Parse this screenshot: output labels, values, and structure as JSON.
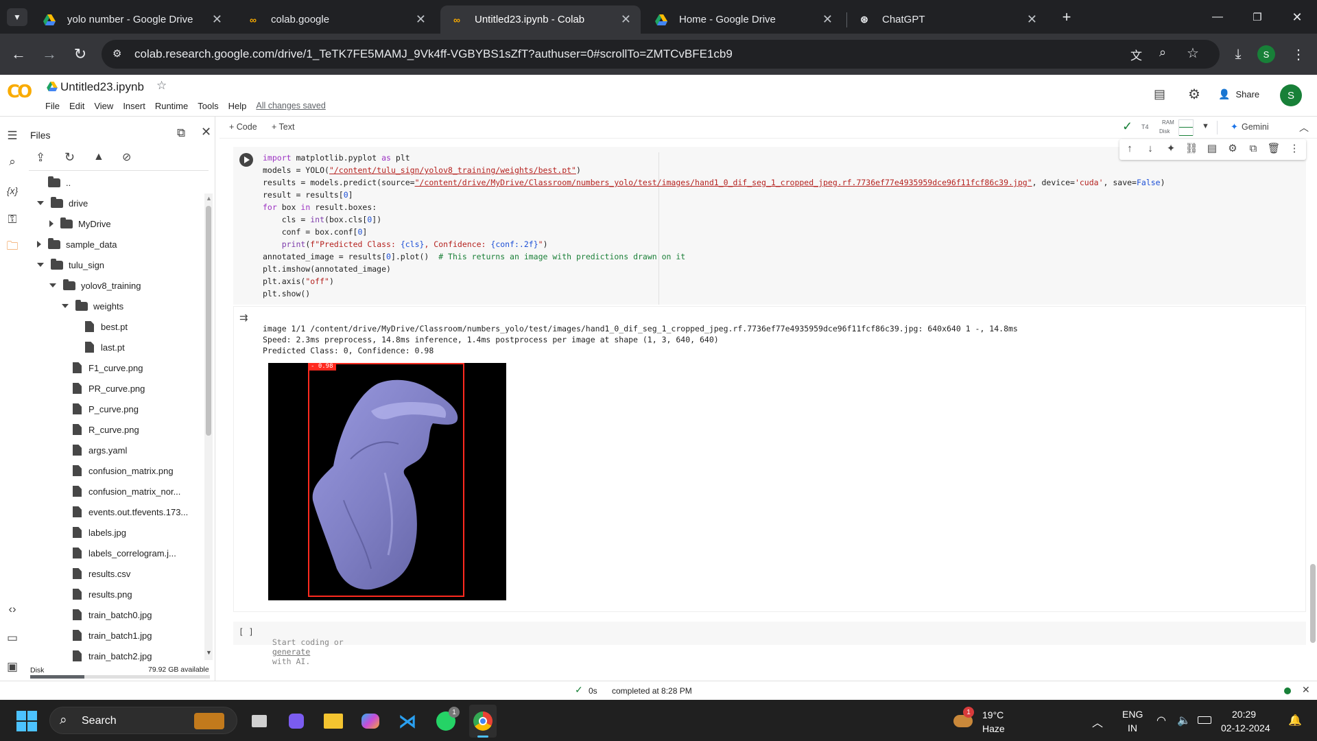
{
  "browser": {
    "tabs": [
      {
        "title": "yolo number - Google Drive",
        "icon": "google-drive-icon",
        "active": false
      },
      {
        "title": "colab.google",
        "icon": "colab-icon",
        "active": false
      },
      {
        "title": "Untitled23.ipynb - Colab",
        "icon": "colab-icon",
        "active": true
      },
      {
        "title": "Home - Google Drive",
        "icon": "google-drive-icon",
        "active": false
      },
      {
        "title": "ChatGPT",
        "icon": "chatgpt-icon",
        "active": false
      }
    ],
    "url": "colab.research.google.com/drive/1_TeTK7FE5MAMJ_9Vk4ff-VGBYBS1sZfT?authuser=0#scrollTo=ZMTCvBFE1cb9",
    "profile_initial": "S"
  },
  "colab": {
    "logo": "CO",
    "notebook_title": "Untitled23.ipynb",
    "menu": [
      "File",
      "Edit",
      "View",
      "Insert",
      "Runtime",
      "Tools",
      "Help"
    ],
    "save_status": "All changes saved",
    "share_label": "Share",
    "user_initial": "S",
    "add_code": "+ Code",
    "add_text": "+ Text",
    "runtime_type": "T4",
    "ram_label": "RAM",
    "disk_label": "Disk",
    "gemini_label": "Gemini"
  },
  "sidebar": {
    "title": "Files",
    "tree": [
      {
        "label": "..",
        "type": "folder",
        "depth": 0,
        "caret": "none"
      },
      {
        "label": "drive",
        "type": "folder",
        "depth": 0,
        "caret": "down"
      },
      {
        "label": "MyDrive",
        "type": "folder",
        "depth": 1,
        "caret": "right"
      },
      {
        "label": "sample_data",
        "type": "folder",
        "depth": 0,
        "caret": "right"
      },
      {
        "label": "tulu_sign",
        "type": "folder",
        "depth": 0,
        "caret": "down"
      },
      {
        "label": "yolov8_training",
        "type": "folder",
        "depth": 1,
        "caret": "down"
      },
      {
        "label": "weights",
        "type": "folder",
        "depth": 2,
        "caret": "down"
      },
      {
        "label": "best.pt",
        "type": "file",
        "depth": 3,
        "caret": "none"
      },
      {
        "label": "last.pt",
        "type": "file",
        "depth": 3,
        "caret": "none"
      },
      {
        "label": "F1_curve.png",
        "type": "file",
        "depth": 2,
        "caret": "none"
      },
      {
        "label": "PR_curve.png",
        "type": "file",
        "depth": 2,
        "caret": "none"
      },
      {
        "label": "P_curve.png",
        "type": "file",
        "depth": 2,
        "caret": "none"
      },
      {
        "label": "R_curve.png",
        "type": "file",
        "depth": 2,
        "caret": "none"
      },
      {
        "label": "args.yaml",
        "type": "file",
        "depth": 2,
        "caret": "none"
      },
      {
        "label": "confusion_matrix.png",
        "type": "file",
        "depth": 2,
        "caret": "none"
      },
      {
        "label": "confusion_matrix_nor...",
        "type": "file",
        "depth": 2,
        "caret": "none"
      },
      {
        "label": "events.out.tfevents.173...",
        "type": "file",
        "depth": 2,
        "caret": "none"
      },
      {
        "label": "labels.jpg",
        "type": "file",
        "depth": 2,
        "caret": "none"
      },
      {
        "label": "labels_correlogram.j...",
        "type": "file",
        "depth": 2,
        "caret": "none"
      },
      {
        "label": "results.csv",
        "type": "file",
        "depth": 2,
        "caret": "none"
      },
      {
        "label": "results.png",
        "type": "file",
        "depth": 2,
        "caret": "none"
      },
      {
        "label": "train_batch0.jpg",
        "type": "file",
        "depth": 2,
        "caret": "none"
      },
      {
        "label": "train_batch1.jpg",
        "type": "file",
        "depth": 2,
        "caret": "none"
      },
      {
        "label": "train_batch2.jpg",
        "type": "file",
        "depth": 2,
        "caret": "none"
      }
    ],
    "disk_label": "Disk",
    "disk_available": "79.92 GB available",
    "disk_used_fraction": 0.3
  },
  "cell": {
    "output": {
      "line1": "image 1/1 /content/drive/MyDrive/Classroom/numbers_yolo/test/images/hand1_0_dif_seg_1_cropped_jpeg.rf.7736ef77e4935959dce96f11fcf86c39.jpg: 640x640 1 -, 14.8ms",
      "line2": "Speed: 2.3ms preprocess, 14.8ms inference, 1.4ms postprocess per image at shape (1, 3, 640, 640)",
      "line3": "Predicted Class: 0, Confidence: 0.98",
      "box_label": "- 0.98"
    }
  },
  "empty_cell": {
    "bracket": "[ ]",
    "prefix": "Start coding or",
    "link": "generate",
    "suffix": "with AI."
  },
  "statusbar": {
    "elapsed": "0s",
    "message": "completed at 8:28 PM"
  },
  "taskbar": {
    "search_label": "Search",
    "weather_temp": "19°C",
    "weather_desc": "Haze",
    "weather_badge": "1",
    "lang_top": "ENG",
    "lang_bottom": "IN",
    "time": "20:29",
    "date": "02-12-2024",
    "whatsapp_badge": "1"
  }
}
